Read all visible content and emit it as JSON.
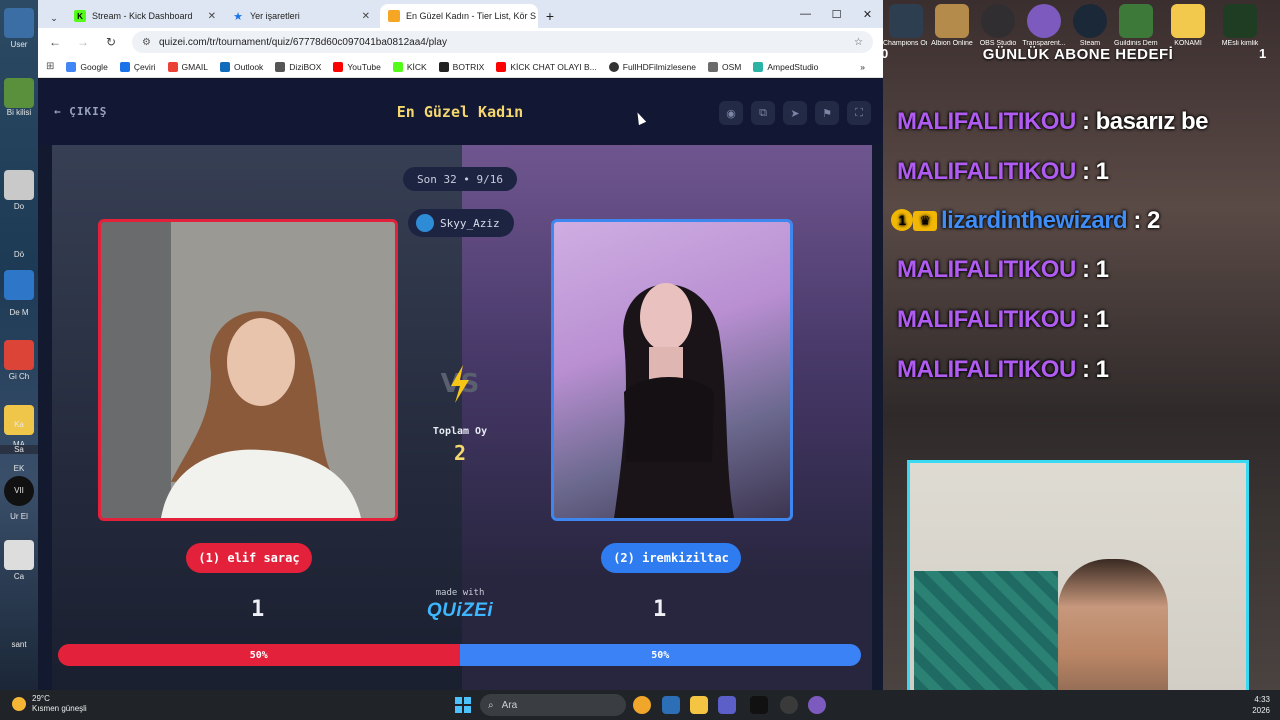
{
  "desktop": {
    "labels": [
      "User",
      "Bi kilisi",
      "Do",
      "Dö",
      "De M",
      "Gi Ch",
      "Ka",
      "MA",
      "Sa",
      "EK",
      "VII",
      "Ur El",
      "Ca",
      "sant"
    ]
  },
  "browser": {
    "tabs": [
      {
        "label": "Stream - Kick Dashboard",
        "icon": "kick-icon",
        "active": false
      },
      {
        "label": "Yer işaretleri",
        "icon": "star-icon",
        "active": false
      },
      {
        "label": "En Güzel Kadın - Tier List, Kör S",
        "icon": "quizei-icon",
        "active": true
      }
    ],
    "new_tab": "+",
    "url": "quizei.com/tr/tournament/quiz/67778d60c097041ba0812aa4/play",
    "bookmarks": [
      "Google",
      "Çeviri",
      "GMAIL",
      "Outlook",
      "DiziBOX",
      "YouTube",
      "KİCK",
      "BOTRIX",
      "KİCK CHAT OLAYI B...",
      "FullHDFilmizlesene",
      "OSM",
      "AmpedStudio"
    ],
    "bookmarks_more": "»"
  },
  "quiz": {
    "exit_label": "ÇIKIŞ",
    "title": "En Güzel Kadın",
    "round_label": "Son 32 • 9/16",
    "player_name": "Skyy_Aziz",
    "total_votes_label": "Toplam Oy",
    "total_votes": "2",
    "vs_label": "VS",
    "left": {
      "name": "(1) elif saraç",
      "votes": "1",
      "percent_label": "50%",
      "percent": 50,
      "color": "#e4213a"
    },
    "right": {
      "name": "(2) iremkiziltac",
      "votes": "1",
      "percent_label": "50%",
      "percent": 50,
      "color": "#3b82f6"
    },
    "made_with": "made with",
    "brand": "QUiZEi"
  },
  "overlay": {
    "icons": [
      "Champions Online",
      "Albion Online",
      "OBS Studio",
      "Transparent...",
      "Steam",
      "Guildinis Demo",
      "KONAMI",
      "MEsli kimlik"
    ],
    "goal_title": "GÜNLÜK ABONE HEDEFİ",
    "goal_left": "0",
    "goal_right": "1",
    "chat": [
      {
        "user": "MALIFALITIKOU",
        "message": "basarız be",
        "badge": false
      },
      {
        "user": "MALIFALITIKOU",
        "message": "1",
        "badge": false
      },
      {
        "user": "lizardinthewizard",
        "message": "2",
        "badge": true,
        "rank": "1"
      },
      {
        "user": "MALIFALITIKOU",
        "message": "1",
        "badge": false
      },
      {
        "user": "MALIFALITIKOU",
        "message": "1",
        "badge": false
      },
      {
        "user": "MALIFALITIKOU",
        "message": "1",
        "badge": false
      }
    ]
  },
  "taskbar": {
    "temp": "29°C",
    "weather": "Kısmen güneşli",
    "search_placeholder": "Ara",
    "time": "4:33",
    "year": "2026"
  }
}
